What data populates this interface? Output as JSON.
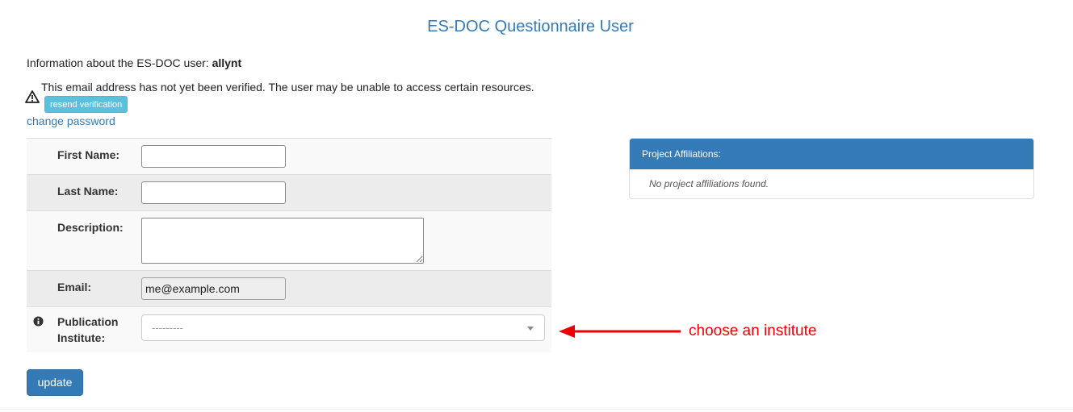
{
  "page": {
    "title": "ES-DOC Questionnaire User"
  },
  "info": {
    "prefix": "Information about the ES-DOC user: ",
    "username": "allynt"
  },
  "warning": {
    "icon": "warning-icon",
    "message": "This email address has not yet been verified. The user may be unable to access certain resources.",
    "resend_label": "resend verification"
  },
  "links": {
    "change_password": "change password"
  },
  "form": {
    "first_name": {
      "label": "First Name:",
      "value": ""
    },
    "last_name": {
      "label": "Last Name:",
      "value": ""
    },
    "description": {
      "label": "Description:",
      "value": ""
    },
    "email": {
      "label": "Email:",
      "value": "me@example.com"
    },
    "institute": {
      "label_line1": "Publication",
      "label_line2": "Institute:",
      "selected": "---------",
      "info_icon": "info-icon"
    }
  },
  "buttons": {
    "update": "update"
  },
  "panel": {
    "heading": "Project Affiliations:",
    "empty_message": "No project affiliations found."
  },
  "annotation": {
    "text": "choose an institute",
    "color": "#ee0000"
  },
  "colors": {
    "primary": "#337ab7",
    "info_button": "#5bc0de"
  }
}
